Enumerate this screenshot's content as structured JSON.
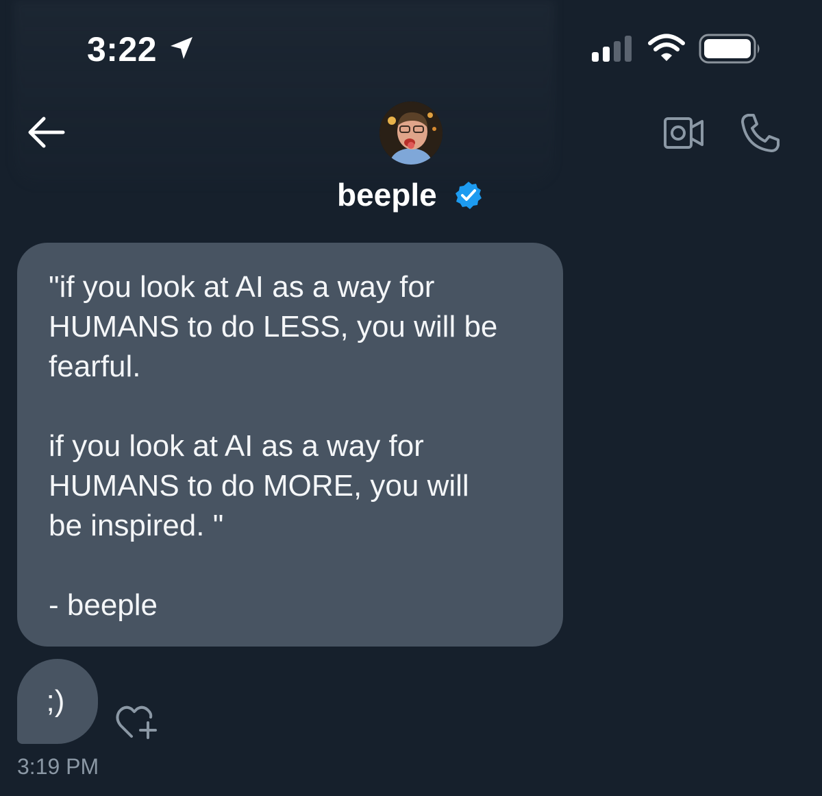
{
  "status_bar": {
    "time": "3:22",
    "icons": [
      "location-arrow-icon",
      "cellular-signal-icon",
      "wifi-icon",
      "battery-icon"
    ]
  },
  "header": {
    "contact_name": "beeple",
    "verified": true,
    "icons": [
      "back-arrow-icon",
      "video-call-icon",
      "phone-call-icon"
    ]
  },
  "messages": [
    {
      "paragraphs": [
        "\"if you look at AI as a way for\nHUMANS to do LESS, you will be\nfearful.",
        "if you look at AI as a way for\nHUMANS to do MORE, you will\nbe inspired. \"",
        "- beeple"
      ]
    },
    {
      "text": ";)",
      "timestamp": "3:19 PM"
    }
  ],
  "colors": {
    "background": "#16202c",
    "bubble": "#485462",
    "verified_badge": "#1d9bf0",
    "icon_muted": "#8b98a5",
    "timestamp": "#8b98a5"
  }
}
